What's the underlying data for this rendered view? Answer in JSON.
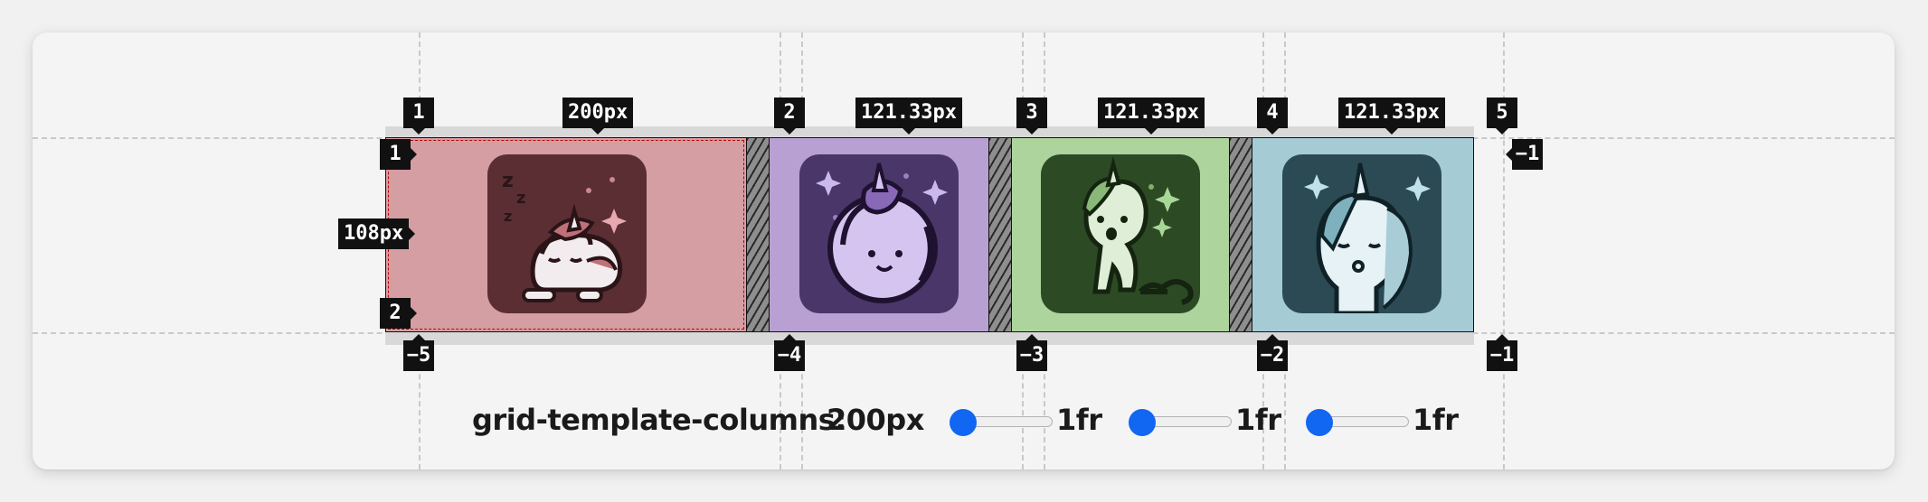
{
  "column_line_numbers": [
    "1",
    "2",
    "3",
    "4",
    "5"
  ],
  "column_line_negative": [
    "−5",
    "−4",
    "−3",
    "−2",
    "−1"
  ],
  "row_line_numbers": [
    "1",
    "2"
  ],
  "row_line_negative": [
    "−1"
  ],
  "column_sizes": [
    "200px",
    "121.33px",
    "121.33px",
    "121.33px"
  ],
  "row_size": "108px",
  "tiles": [
    {
      "name": "sleeping-unicorn-icon",
      "bg": "#d59ea3",
      "tile_bg": "#5a2e33"
    },
    {
      "name": "curled-unicorn-icon",
      "bg": "#b8a0d3",
      "tile_bg": "#4a3668"
    },
    {
      "name": "dancing-unicorn-icon",
      "bg": "#acd49c",
      "tile_bg": "#2c4a24"
    },
    {
      "name": "kissing-unicorn-icon",
      "bg": "#a5ccd5",
      "tile_bg": "#2b4a54"
    }
  ],
  "controls": {
    "label": "grid-template-columns:",
    "first_value": "200px",
    "sliders": [
      {
        "value": 1,
        "unit_label": "1fr"
      },
      {
        "value": 1,
        "unit_label": "1fr"
      },
      {
        "value": 1,
        "unit_label": "1fr"
      }
    ],
    "accent_color": "#1166f2"
  }
}
